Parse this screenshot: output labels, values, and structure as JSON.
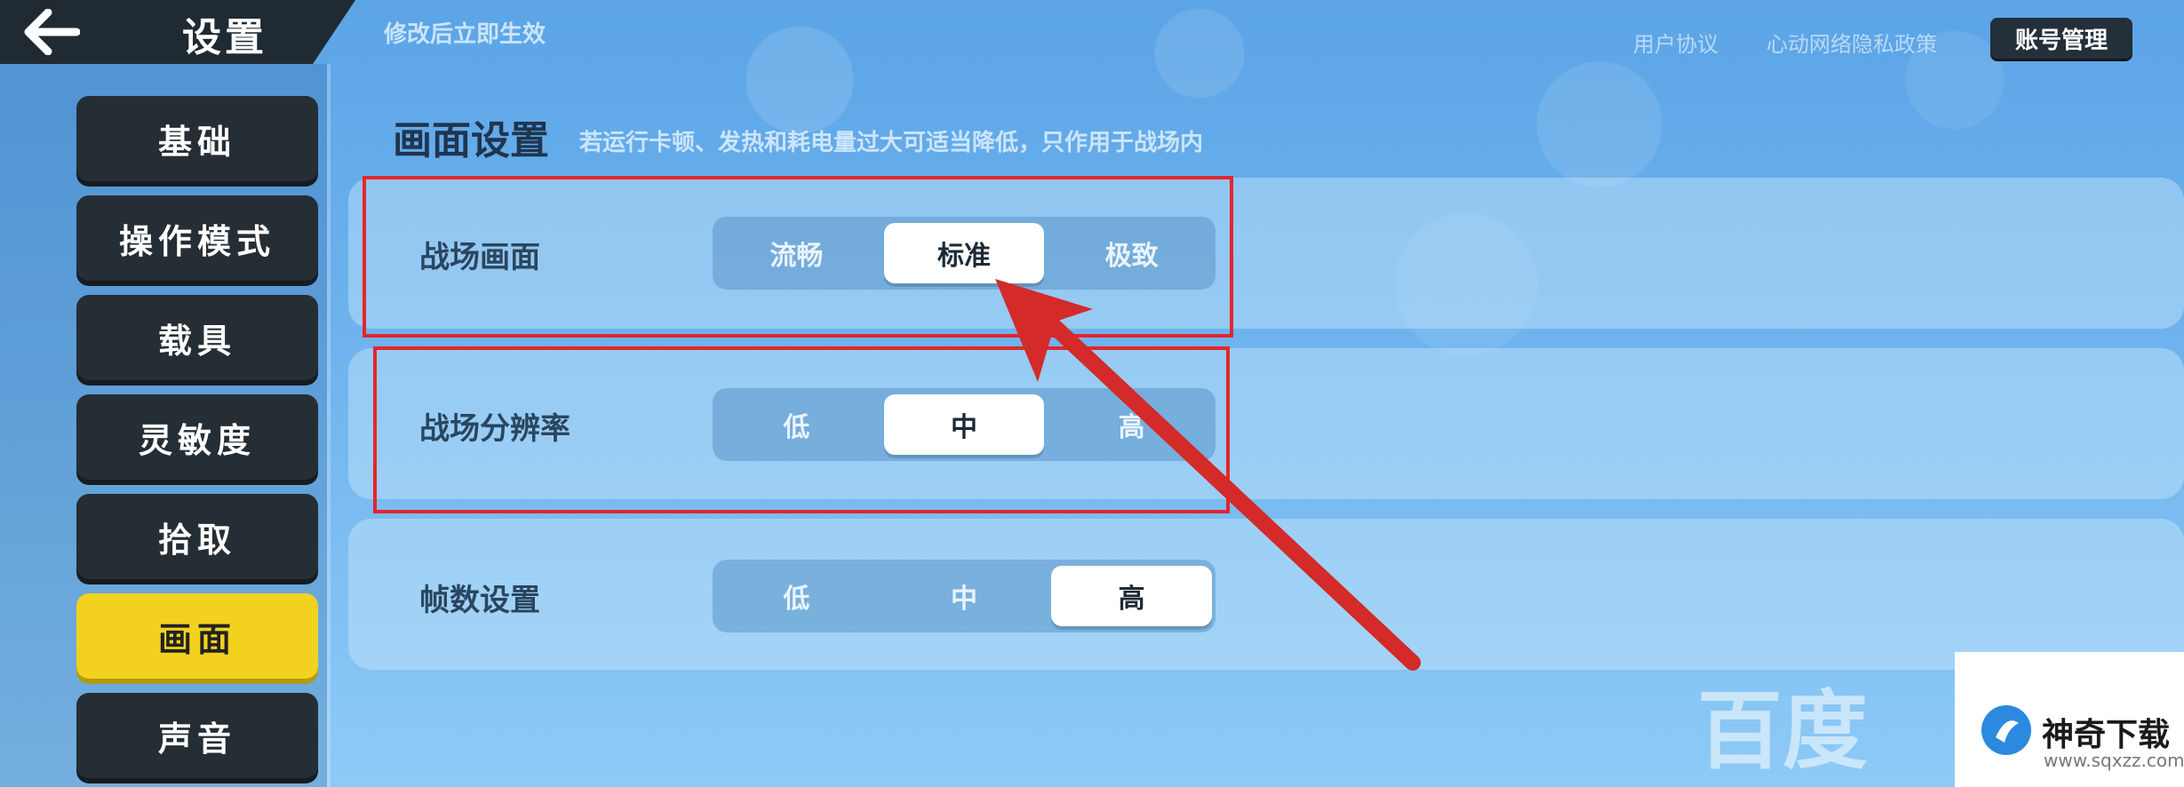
{
  "header": {
    "title": "设置",
    "notice": "修改后立即生效",
    "links": [
      "用户协议",
      "心动网络隐私政策"
    ],
    "account_button": "账号管理"
  },
  "sidebar": {
    "items": [
      {
        "label": "基础",
        "active": false
      },
      {
        "label": "操作模式",
        "active": false
      },
      {
        "label": "载具",
        "active": false
      },
      {
        "label": "灵敏度",
        "active": false
      },
      {
        "label": "拾取",
        "active": false
      },
      {
        "label": "画面",
        "active": true
      },
      {
        "label": "声音",
        "active": false
      }
    ]
  },
  "section": {
    "title": "画面设置",
    "description": "若运行卡顿、发热和耗电量过大可适当降低，只作用于战场内"
  },
  "settings": [
    {
      "label": "战场画面",
      "options": [
        "流畅",
        "标准",
        "极致"
      ],
      "selected": 1
    },
    {
      "label": "战场分辨率",
      "options": [
        "低",
        "中",
        "高"
      ],
      "selected": 1
    },
    {
      "label": "帧数设置",
      "options": [
        "低",
        "中",
        "高"
      ],
      "selected": 2
    }
  ],
  "watermark": {
    "baidu": "百度",
    "brand": "神奇下载",
    "url": "www.sqxzz.com"
  },
  "colors": {
    "active_tab": "#f2d21e",
    "annotation": "#e3262c"
  }
}
